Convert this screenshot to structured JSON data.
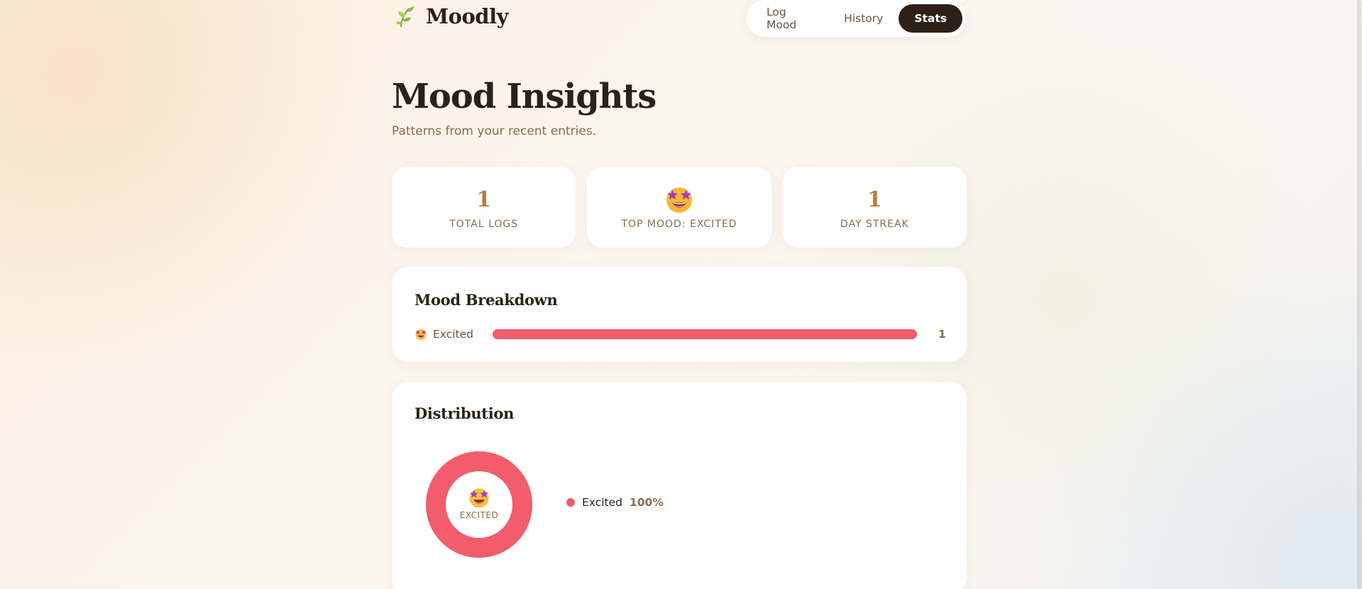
{
  "app": {
    "name": "Moodly",
    "logo_icon": "leaf-sprout-icon"
  },
  "nav": {
    "items": [
      {
        "label": "Log Mood",
        "active": false
      },
      {
        "label": "History",
        "active": false
      },
      {
        "label": "Stats",
        "active": true
      }
    ]
  },
  "page": {
    "title": "Mood Insights",
    "subtitle": "Patterns from your recent entries."
  },
  "stats": [
    {
      "value": "1",
      "label": "TOTAL LOGS"
    },
    {
      "value": "",
      "icon": "star-struck-emoji-icon",
      "label": "TOP MOOD: EXCITED"
    },
    {
      "value": "1",
      "label": "DAY STREAK"
    }
  ],
  "breakdown": {
    "title": "Mood Breakdown",
    "rows": [
      {
        "icon": "star-struck-emoji-icon",
        "label": "Excited",
        "count": "1",
        "fraction": 1.0,
        "color": "#f25c6b"
      }
    ]
  },
  "distribution": {
    "title": "Distribution",
    "center_label": "EXCITED",
    "center_icon": "star-struck-emoji-icon",
    "legend": [
      {
        "label": "Excited",
        "percent": "100%",
        "fraction": 1.0,
        "color": "#f25c6b"
      }
    ]
  },
  "colors": {
    "accent": "#c07a3d",
    "excited": "#f25c6b",
    "dark": "#2b2118",
    "muted": "#8a6a4c"
  }
}
